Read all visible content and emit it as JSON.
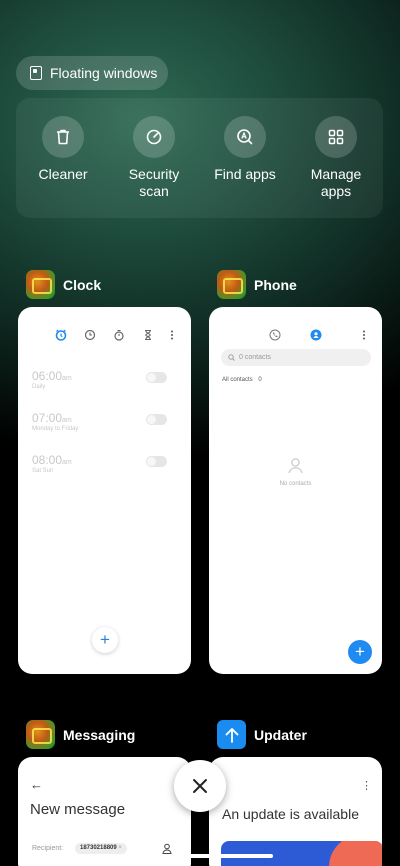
{
  "top": {
    "floating_windows_label": "Floating windows",
    "tools": [
      {
        "label": "Cleaner",
        "icon": "trash-icon"
      },
      {
        "label": "Security scan",
        "icon": "security-scan-icon"
      },
      {
        "label": "Find apps",
        "icon": "find-apps-icon"
      },
      {
        "label": "Manage apps",
        "icon": "grid-icon"
      }
    ]
  },
  "apps": {
    "clock": {
      "name": "Clock",
      "alarms": [
        {
          "time": "06:00",
          "unit": "am",
          "repeat": "Daily"
        },
        {
          "time": "07:00",
          "unit": "am",
          "repeat": "Monday to Friday"
        },
        {
          "time": "08:00",
          "unit": "am",
          "repeat": "Sat Sun"
        }
      ],
      "add_label": "+"
    },
    "phone": {
      "name": "Phone",
      "search_placeholder": "0 contacts",
      "all_contacts_label": "All contacts",
      "all_contacts_count": "0",
      "empty_label": "No contacts",
      "add_label": "+"
    },
    "messaging": {
      "name": "Messaging",
      "back_glyph": "←",
      "title": "New message",
      "recipient_label": "Recipient:",
      "recipient_chip": "18730218809"
    },
    "updater": {
      "name": "Updater",
      "menu_glyph": "⋮",
      "title": "An update is available"
    }
  },
  "colors": {
    "accent_blue": "#1f8af0",
    "updater_icon": "#1a8cf0"
  }
}
